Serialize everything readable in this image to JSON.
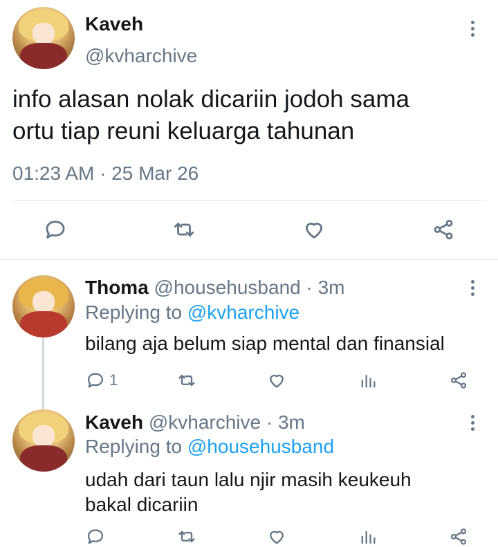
{
  "main_tweet": {
    "author_name": "Kaveh",
    "author_handle": "@kvharchive",
    "text_line1": "info alasan nolak dicariin jodoh sama",
    "text_line2": "ortu tiap reuni keluarga tahunan",
    "timestamp": "01:23 AM · 25 Mar 26"
  },
  "replies": [
    {
      "author_name": "Thoma",
      "author_handle": "@househusband",
      "time": "· 3m",
      "replying_to_prefix": "Replying to",
      "replying_to_handle": "@kvharchive",
      "text_line1": "bilang aja belum siap mental dan finansial",
      "text_line2": "",
      "reply_count": "1"
    },
    {
      "author_name": "Kaveh",
      "author_handle": "@kvharchive",
      "time": "· 3m",
      "replying_to_prefix": "Replying to",
      "replying_to_handle": "@househusband",
      "text_line1": "udah dari taun lalu njir masih keukeuh",
      "text_line2": "bakal dicariin",
      "reply_count": ""
    }
  ],
  "icons": {
    "reply": "reply-icon",
    "retweet": "retweet-icon",
    "like": "heart-icon",
    "views": "analytics-icon",
    "share": "share-icon",
    "more": "more-vertical-icon"
  },
  "colors": {
    "text": "#14171a",
    "secondary": "#657786",
    "link": "#1da1f2",
    "divider": "#e1e8ed"
  }
}
